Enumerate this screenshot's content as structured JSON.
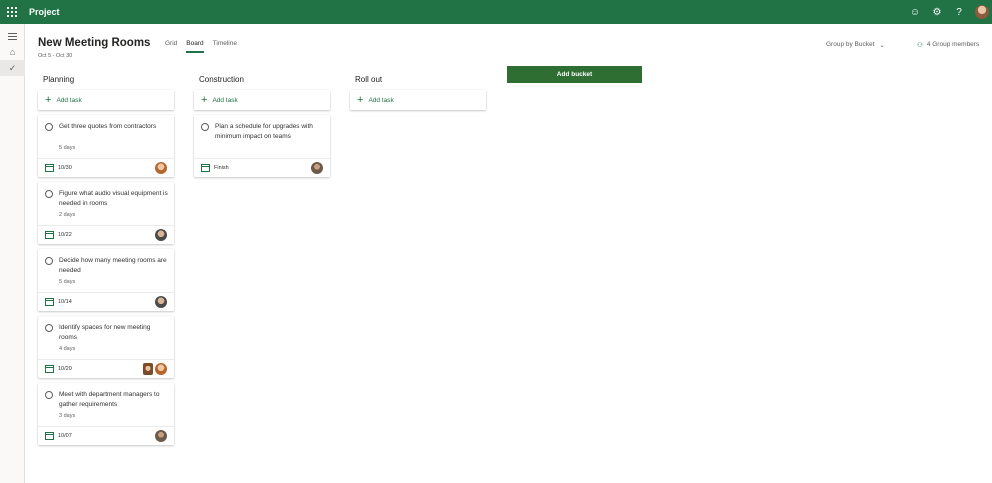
{
  "app": {
    "title": "Project"
  },
  "project": {
    "title": "New Meeting Rooms",
    "dates": "Oct 5 - Oct 30",
    "tabs": [
      {
        "label": "Grid",
        "active": false
      },
      {
        "label": "Board",
        "active": true
      },
      {
        "label": "Timeline",
        "active": false
      }
    ],
    "group_by": "Group by Bucket",
    "members": "4 Group members"
  },
  "add_task_label": "Add task",
  "add_bucket_label": "Add bucket",
  "buckets": [
    {
      "name": "Planning",
      "tasks": [
        {
          "title": "Get three quotes from contractors",
          "duration": "5 days",
          "date": "10/30",
          "avatars": [
            "av-a"
          ]
        },
        {
          "title": "Figure what audio visual equipment is needed in rooms",
          "duration": "2 days",
          "date": "10/22",
          "avatars": [
            "av-b"
          ]
        },
        {
          "title": "Decide how many meeting rooms are needed",
          "duration": "5 days",
          "date": "10/14",
          "avatars": [
            "av-b"
          ]
        },
        {
          "title": "Identify spaces for new meeting rooms",
          "duration": "4 days",
          "date": "10/20",
          "avatars": [
            "av-d",
            "av-a"
          ]
        },
        {
          "title": "Meet with department managers to gather requirements",
          "duration": "3 days",
          "date": "10/07",
          "avatars": [
            "av-c"
          ]
        }
      ]
    },
    {
      "name": "Construction",
      "tasks": [
        {
          "title": "Plan a schedule for upgrades with minimum impact on teams",
          "duration": "",
          "date": "Finish",
          "avatars": [
            "av-c"
          ]
        }
      ]
    },
    {
      "name": "Roll out",
      "tasks": []
    }
  ],
  "icons": {
    "waffle": "waffle-icon",
    "smiley": "feedback-icon",
    "settings": "gear-icon",
    "help": "help-icon",
    "rail_menu": "hamburger-icon",
    "rail_home": "home-icon",
    "rail_check": "check-icon",
    "calendar": "calendar-icon"
  },
  "colors": {
    "brand": "#217346",
    "add_bucket": "#2f6e33"
  }
}
